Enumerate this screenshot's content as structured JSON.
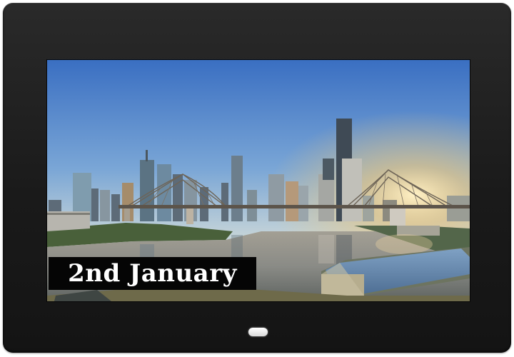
{
  "device": {
    "type": "digital photo frame",
    "frame_color": "#1e1e1e",
    "indicator_icon": "power-indicator-icon"
  },
  "photo": {
    "subject": "city-skyline-river-bridge",
    "sky_top_color": "#3c73c4",
    "sky_bottom_color": "#f4d59a",
    "water_color": "#8a8e8c",
    "bridge_color": "#6b6358"
  },
  "caption": {
    "text": "2nd January"
  }
}
